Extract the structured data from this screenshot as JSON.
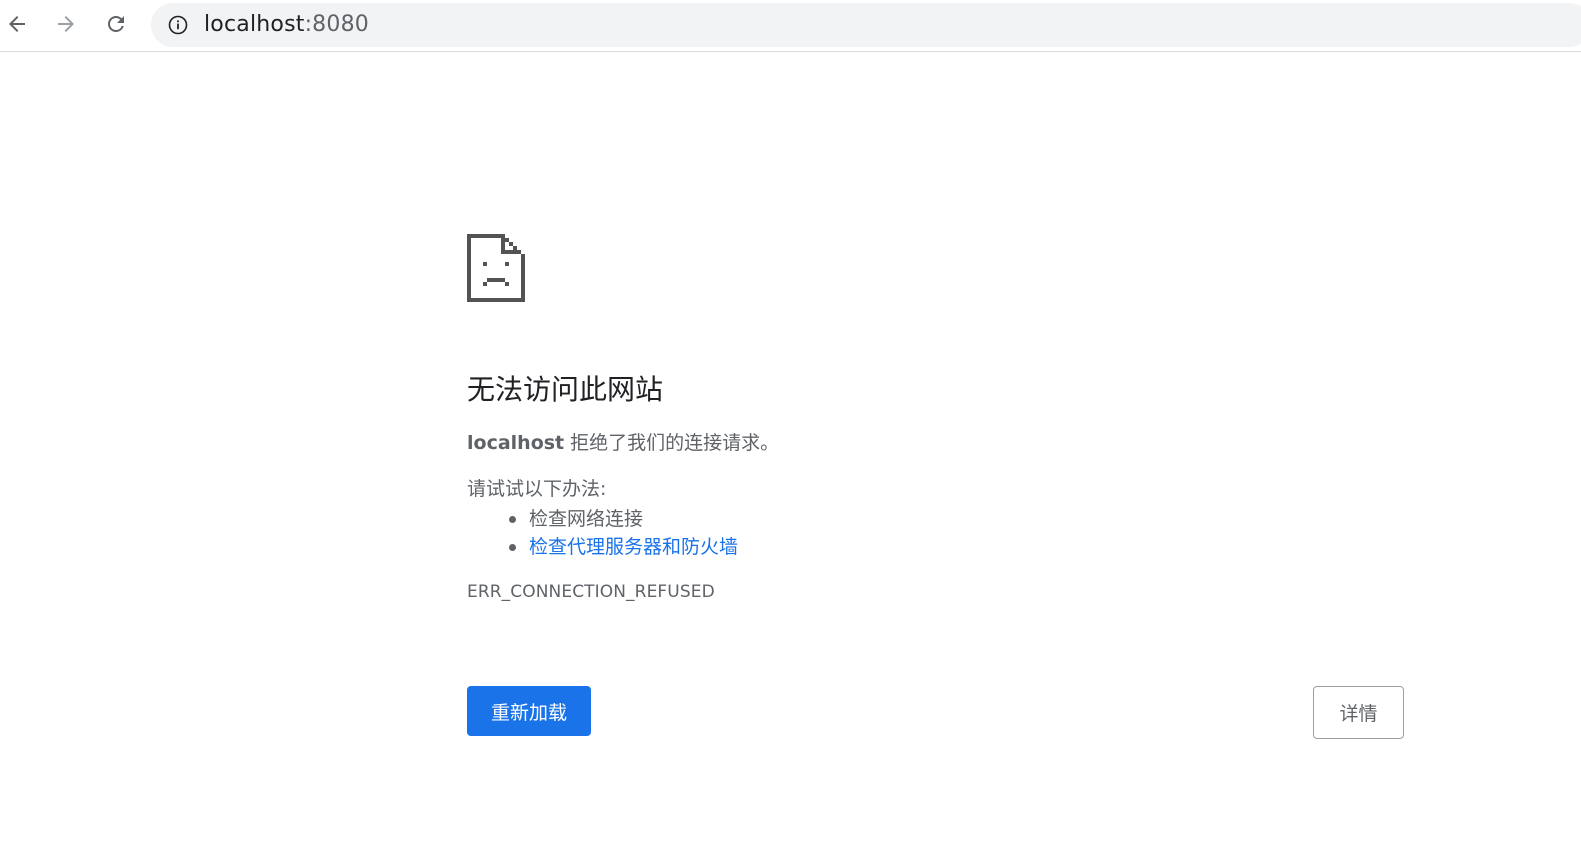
{
  "browser": {
    "url_host": "localhost",
    "url_port": ":8080",
    "icons": {
      "back": "arrow-left-icon",
      "forward": "arrow-right-icon",
      "reload": "reload-icon",
      "info": "info-icon"
    }
  },
  "error_page": {
    "icon": "sad-page-icon",
    "title": "无法访问此网站",
    "host": "localhost",
    "message": " 拒绝了我们的连接请求。",
    "try_heading": "请试试以下办法:",
    "suggestions": [
      {
        "text": "检查网络连接",
        "link": false
      },
      {
        "text": "检查代理服务器和防火墙",
        "link": true
      }
    ],
    "error_code": "ERR_CONNECTION_REFUSED",
    "reload_button": "重新加载",
    "details_button": "详情"
  },
  "colors": {
    "accent": "#1a73e8",
    "text_secondary": "#5f6368",
    "omnibox_bg": "#f1f3f4"
  }
}
